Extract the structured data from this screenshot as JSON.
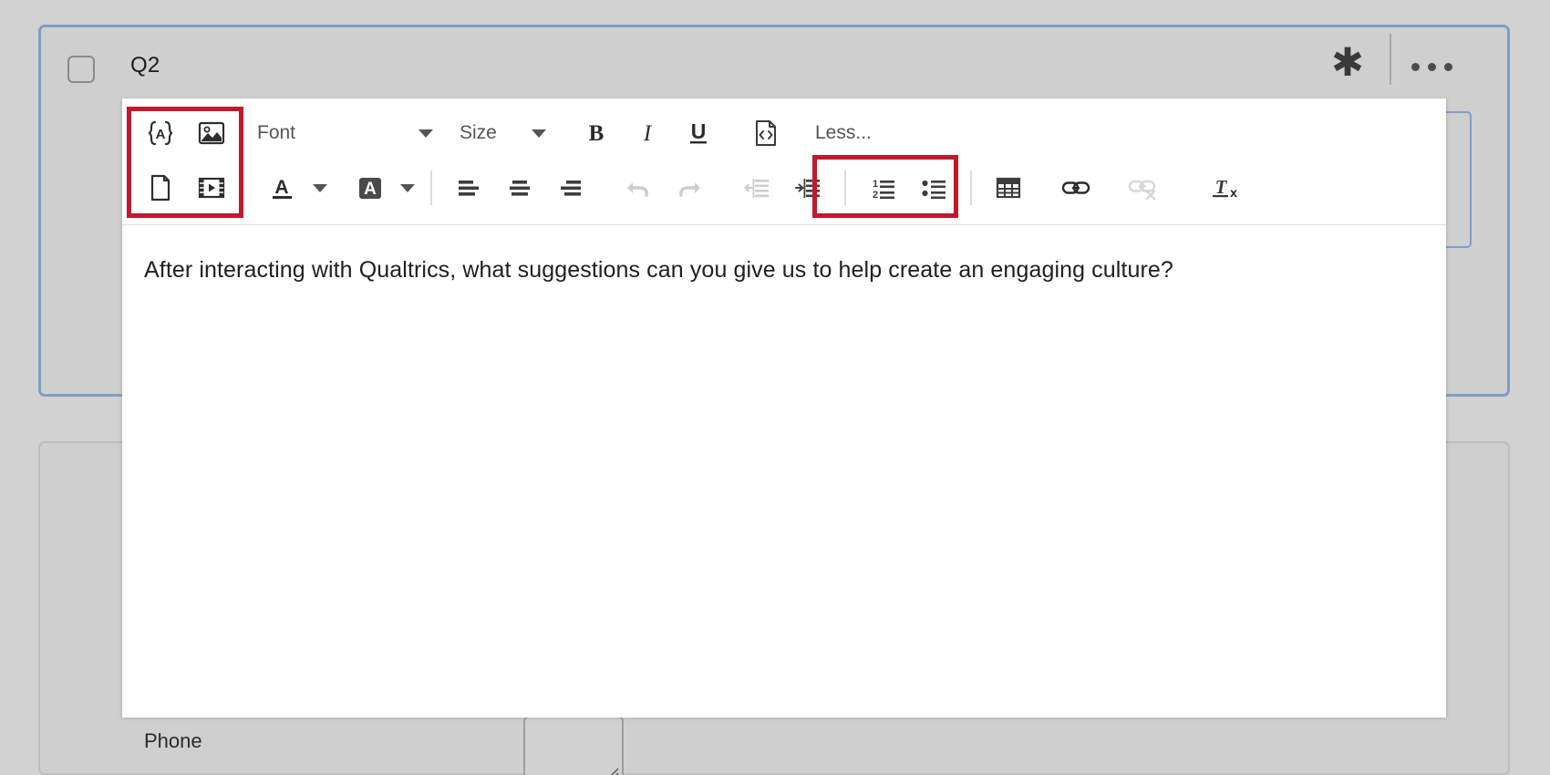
{
  "question_card": {
    "label": "Q2",
    "checkbox_checked": false,
    "required_icon": "asterisk-icon",
    "menu_icon": "ellipsis-icon",
    "border_color": "#7e9ec4"
  },
  "lower_card": {
    "phone_label": "Phone",
    "textarea_value": "",
    "resize_handle_icon": "resize-grip-icon"
  },
  "editor": {
    "body_text": "After interacting with Qualtrics, what suggestions can you give us to help create an engaging culture?",
    "toolbar": {
      "row1": [
        {
          "name": "piped-text-icon",
          "label": "{A}",
          "type": "icon",
          "enabled": true
        },
        {
          "name": "insert-image-icon",
          "label": "image",
          "type": "icon",
          "enabled": true
        },
        {
          "name": "font-family-select",
          "label": "Font",
          "type": "select",
          "enabled": true
        },
        {
          "name": "font-size-select",
          "label": "Size",
          "type": "select",
          "enabled": true
        },
        {
          "name": "bold-button",
          "label": "B",
          "type": "icon",
          "enabled": true
        },
        {
          "name": "italic-button",
          "label": "I",
          "type": "icon",
          "enabled": true
        },
        {
          "name": "underline-button",
          "label": "U",
          "type": "icon",
          "enabled": true
        },
        {
          "name": "source-code-button",
          "label": "source",
          "type": "icon",
          "enabled": true
        },
        {
          "name": "less-toggle",
          "label": "Less...",
          "type": "text",
          "enabled": true
        }
      ],
      "row2": [
        {
          "name": "insert-file-icon",
          "label": "file",
          "type": "icon",
          "enabled": true
        },
        {
          "name": "insert-video-icon",
          "label": "video",
          "type": "icon",
          "enabled": true
        },
        {
          "name": "text-color-button",
          "label": "A",
          "type": "icon",
          "enabled": true
        },
        {
          "name": "highlight-color-button",
          "label": "A",
          "type": "icon",
          "enabled": true
        },
        {
          "name": "align-left-button",
          "label": "align-left",
          "type": "icon",
          "enabled": true
        },
        {
          "name": "align-center-button",
          "label": "align-center",
          "type": "icon",
          "enabled": true
        },
        {
          "name": "align-right-button",
          "label": "align-right",
          "type": "icon",
          "enabled": true
        },
        {
          "name": "undo-button",
          "label": "undo",
          "type": "icon",
          "enabled": false
        },
        {
          "name": "redo-button",
          "label": "redo",
          "type": "icon",
          "enabled": false
        },
        {
          "name": "outdent-button",
          "label": "outdent",
          "type": "icon",
          "enabled": false
        },
        {
          "name": "indent-button",
          "label": "indent",
          "type": "icon",
          "enabled": true
        },
        {
          "name": "numbered-list-button",
          "label": "ordered-list",
          "type": "icon",
          "enabled": true
        },
        {
          "name": "bullet-list-button",
          "label": "bullet-list",
          "type": "icon",
          "enabled": true
        },
        {
          "name": "insert-table-button",
          "label": "table",
          "type": "icon",
          "enabled": true
        },
        {
          "name": "insert-link-button",
          "label": "link",
          "type": "icon",
          "enabled": true
        },
        {
          "name": "remove-link-button",
          "label": "unlink",
          "type": "icon",
          "enabled": false
        },
        {
          "name": "clear-formatting-button",
          "label": "Tx",
          "type": "icon",
          "enabled": true
        }
      ],
      "highlight_color": "#c0192c",
      "highlight_groups": [
        {
          "name": "insert-media-group",
          "items": [
            "piped-text-icon",
            "insert-image-icon",
            "insert-file-icon",
            "insert-video-icon"
          ]
        },
        {
          "name": "table-link-group",
          "items": [
            "insert-table-button",
            "insert-link-button",
            "remove-link-button"
          ]
        }
      ]
    }
  }
}
